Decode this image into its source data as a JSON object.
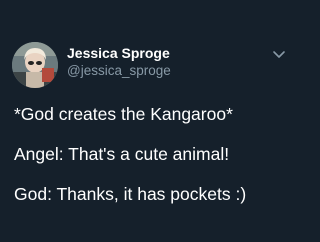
{
  "tweet": {
    "author": {
      "display_name": "Jessica Sproge",
      "handle": "@jessica_sproge",
      "avatar_icon": "user-avatar-photo"
    },
    "menu_icon": "chevron-down-icon",
    "lines": [
      "*God creates the Kangaroo*",
      "Angel: That's a cute animal!",
      "God: Thanks, it has pockets :)"
    ]
  },
  "colors": {
    "background": "#15202b",
    "text_primary": "#ffffff",
    "text_secondary": "#8899a6"
  }
}
